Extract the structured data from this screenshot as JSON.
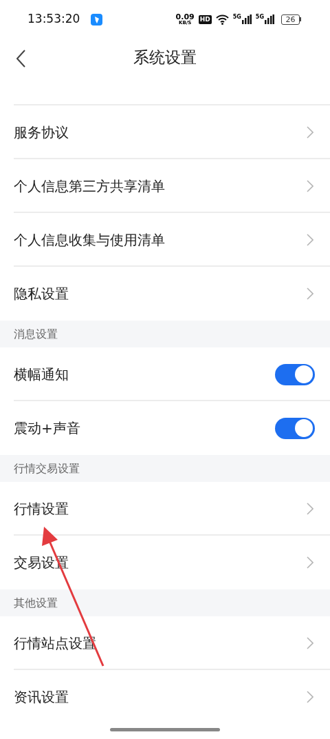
{
  "status_bar": {
    "time": "13:53:20",
    "net_speed": "0.09",
    "net_unit": "KB/S",
    "hd": "HD",
    "signals": [
      "5G",
      "5G"
    ],
    "battery": "26"
  },
  "header": {
    "title": "系统设置"
  },
  "sections": [
    {
      "items": [
        {
          "label": "服务协议",
          "kind": "link"
        },
        {
          "label": "个人信息第三方共享清单",
          "kind": "link"
        },
        {
          "label": "个人信息收集与使用清单",
          "kind": "link"
        },
        {
          "label": "隐私设置",
          "kind": "link"
        }
      ]
    },
    {
      "title": "消息设置",
      "items": [
        {
          "label": "横幅通知",
          "kind": "toggle",
          "on": true
        },
        {
          "label": "震动+声音",
          "kind": "toggle",
          "on": true
        }
      ]
    },
    {
      "title": "行情交易设置",
      "items": [
        {
          "label": "行情设置",
          "kind": "link"
        },
        {
          "label": "交易设置",
          "kind": "link"
        }
      ]
    },
    {
      "title": "其他设置",
      "items": [
        {
          "label": "行情站点设置",
          "kind": "link"
        },
        {
          "label": "资讯设置",
          "kind": "link"
        }
      ]
    }
  ]
}
